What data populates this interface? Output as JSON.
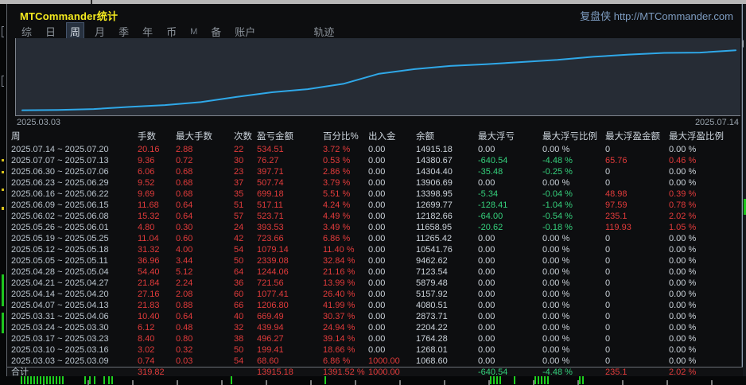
{
  "window": {
    "title": "MTCommander统计",
    "brand": "复盘侠 http://MTCommander.com"
  },
  "menu": {
    "items": [
      "综",
      "日",
      "周",
      "月",
      "季",
      "年",
      "币",
      "M",
      "备",
      "账户",
      "轨迹"
    ],
    "selected": "周"
  },
  "chart_data": {
    "type": "line",
    "title": "",
    "x_start": "2025.03.03",
    "x_end": "2025.07.14",
    "xlabel": "",
    "ylabel": "余额",
    "ylim": [
      0,
      15500
    ],
    "grid": false,
    "legend": "none",
    "line_color": "#2fa8e8",
    "series": [
      {
        "name": "余额",
        "values": [
          1000,
          1068.6,
          1268.01,
          1764.28,
          2204.22,
          2873.71,
          4080.51,
          5157.92,
          5879.48,
          7123.54,
          9462.62,
          10541.76,
          11265.42,
          11658.95,
          12182.66,
          12699.77,
          13398.95,
          13906.69,
          14304.4,
          14380.67,
          14915.18
        ]
      }
    ]
  },
  "table": {
    "headers": [
      "周",
      "手数",
      "最大手数",
      "次数",
      "盈亏金额",
      "百分比%",
      "出入金",
      "余额",
      "最大浮亏",
      "最大浮亏比例",
      "最大浮盈金额",
      "最大浮盈比例"
    ],
    "rows": [
      [
        "2025.07.14 ~ 2025.07.20",
        "20.16",
        "2.88",
        "22",
        "534.51",
        "3.72 %",
        "0.00",
        "14915.18",
        "0.00",
        "0.00 %",
        "0",
        "0.00 %"
      ],
      [
        "2025.07.07 ~ 2025.07.13",
        "9.36",
        "0.72",
        "30",
        "76.27",
        "0.53 %",
        "0.00",
        "14380.67",
        "-640.54",
        "-4.48 %",
        "65.76",
        "0.46 %"
      ],
      [
        "2025.06.30 ~ 2025.07.06",
        "6.06",
        "0.68",
        "23",
        "397.71",
        "2.86 %",
        "0.00",
        "14304.40",
        "-35.48",
        "-0.25 %",
        "0",
        "0.00 %"
      ],
      [
        "2025.06.23 ~ 2025.06.29",
        "9.52",
        "0.68",
        "37",
        "507.74",
        "3.79 %",
        "0.00",
        "13906.69",
        "0.00",
        "0.00 %",
        "0",
        "0.00 %"
      ],
      [
        "2025.06.16 ~ 2025.06.22",
        "9.69",
        "0.68",
        "35",
        "699.18",
        "5.51 %",
        "0.00",
        "13398.95",
        "-5.34",
        "-0.04 %",
        "48.98",
        "0.39 %"
      ],
      [
        "2025.06.09 ~ 2025.06.15",
        "11.68",
        "0.64",
        "51",
        "517.11",
        "4.24 %",
        "0.00",
        "12699.77",
        "-128.41",
        "-1.04 %",
        "97.59",
        "0.78 %"
      ],
      [
        "2025.06.02 ~ 2025.06.08",
        "15.32",
        "0.64",
        "57",
        "523.71",
        "4.49 %",
        "0.00",
        "12182.66",
        "-64.00",
        "-0.54 %",
        "235.1",
        "2.02 %"
      ],
      [
        "2025.05.26 ~ 2025.06.01",
        "4.80",
        "0.30",
        "24",
        "393.53",
        "3.49 %",
        "0.00",
        "11658.95",
        "-20.62",
        "-0.18 %",
        "119.93",
        "1.05 %"
      ],
      [
        "2025.05.19 ~ 2025.05.25",
        "11.04",
        "0.60",
        "42",
        "723.66",
        "6.86 %",
        "0.00",
        "11265.42",
        "0.00",
        "0.00 %",
        "0",
        "0.00 %"
      ],
      [
        "2025.05.12 ~ 2025.05.18",
        "31.32",
        "4.00",
        "54",
        "1079.14",
        "11.40 %",
        "0.00",
        "10541.76",
        "0.00",
        "0.00 %",
        "0",
        "0.00 %"
      ],
      [
        "2025.05.05 ~ 2025.05.11",
        "36.96",
        "3.44",
        "50",
        "2339.08",
        "32.84 %",
        "0.00",
        "9462.62",
        "0.00",
        "0.00 %",
        "0",
        "0.00 %"
      ],
      [
        "2025.04.28 ~ 2025.05.04",
        "54.40",
        "5.12",
        "64",
        "1244.06",
        "21.16 %",
        "0.00",
        "7123.54",
        "0.00",
        "0.00 %",
        "0",
        "0.00 %"
      ],
      [
        "2025.04.21 ~ 2025.04.27",
        "21.84",
        "2.24",
        "36",
        "721.56",
        "13.99 %",
        "0.00",
        "5879.48",
        "0.00",
        "0.00 %",
        "0",
        "0.00 %"
      ],
      [
        "2025.04.14 ~ 2025.04.20",
        "27.16",
        "2.08",
        "60",
        "1077.41",
        "26.40 %",
        "0.00",
        "5157.92",
        "0.00",
        "0.00 %",
        "0",
        "0.00 %"
      ],
      [
        "2025.04.07 ~ 2025.04.13",
        "21.83",
        "0.88",
        "66",
        "1206.80",
        "41.99 %",
        "0.00",
        "4080.51",
        "0.00",
        "0.00 %",
        "0",
        "0.00 %"
      ],
      [
        "2025.03.31 ~ 2025.04.06",
        "10.40",
        "0.64",
        "40",
        "669.49",
        "30.37 %",
        "0.00",
        "2873.71",
        "0.00",
        "0.00 %",
        "0",
        "0.00 %"
      ],
      [
        "2025.03.24 ~ 2025.03.30",
        "6.12",
        "0.48",
        "32",
        "439.94",
        "24.94 %",
        "0.00",
        "2204.22",
        "0.00",
        "0.00 %",
        "0",
        "0.00 %"
      ],
      [
        "2025.03.17 ~ 2025.03.23",
        "8.40",
        "0.80",
        "38",
        "496.27",
        "39.14 %",
        "0.00",
        "1764.28",
        "0.00",
        "0.00 %",
        "0",
        "0.00 %"
      ],
      [
        "2025.03.10 ~ 2025.03.16",
        "3.02",
        "0.32",
        "50",
        "199.41",
        "18.66 %",
        "0.00",
        "1268.01",
        "0.00",
        "0.00 %",
        "0",
        "0.00 %"
      ],
      [
        "2025.03.03 ~ 2025.03.09",
        "0.74",
        "0.03",
        "54",
        "68.60",
        "6.86 %",
        "1000.00",
        "1068.60",
        "0.00",
        "0.00 %",
        "0",
        "0.00 %"
      ]
    ],
    "total_row": [
      "合计",
      "319.82",
      "",
      "",
      "13915.18",
      "1391.52 %",
      "1000.00",
      "",
      "-640.54",
      "-4.48 %",
      "235.1",
      "2.02 %"
    ]
  },
  "colors": {
    "accent_yellow": "#f4ea1e",
    "brand_blue": "#7e9dc2",
    "gain_red": "#e23b3b",
    "loss_green": "#35d07c",
    "neutral": "#ccd3da",
    "chart_line": "#2fa8e8",
    "chart_bg": "#262c35"
  }
}
